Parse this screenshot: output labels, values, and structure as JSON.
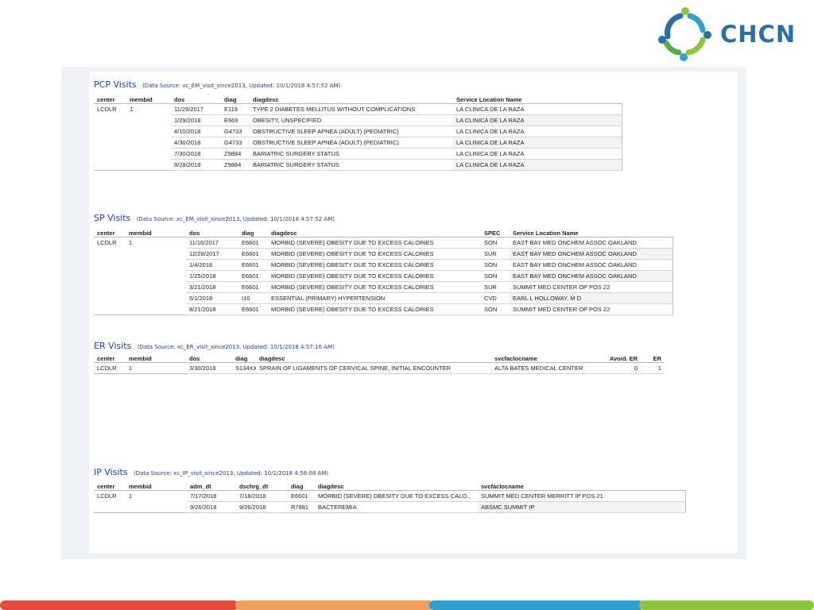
{
  "brand": {
    "name": "CHCN",
    "colors": {
      "primary": "#2b6fa3",
      "green": "#8cc63f",
      "red": "#e34b3e",
      "orange": "#f0a05a",
      "blue": "#2f9fd0"
    }
  },
  "pcp": {
    "title": "PCP Visits",
    "source": "(Data Source: xc_EM_visit_since2013, Updated: 10/1/2018 4:57:52 AM)",
    "headers": {
      "center": "center",
      "membid": "membid",
      "dos": "dos",
      "diag": "diag",
      "diagdesc": "diagdesc",
      "loc": "Service Location Name"
    },
    "group": {
      "center": "LCDLR",
      "membid": "1:"
    },
    "rows": [
      {
        "dos": "11/29/2017",
        "diag": "E119",
        "diagdesc": "TYPE 2 DIABETES MELLITUS WITHOUT COMPLICATIONS",
        "loc": "LA CLINICA DE LA RAZA"
      },
      {
        "dos": "1/29/2018",
        "diag": "E669",
        "diagdesc": "OBESITY, UNSPECIFIED",
        "loc": "LA CLINICA DE LA RAZA"
      },
      {
        "dos": "4/10/2018",
        "diag": "G4733",
        "diagdesc": "OBSTRUCTIVE SLEEP APNEA (ADULT) (PEDIATRIC)",
        "loc": "LA CLINICA DE LA RAZA"
      },
      {
        "dos": "4/30/2018",
        "diag": "G4733",
        "diagdesc": "OBSTRUCTIVE SLEEP APNEA (ADULT) (PEDIATRIC)",
        "loc": "LA CLINICA DE LA RAZA"
      },
      {
        "dos": "7/30/2018",
        "diag": "Z9884",
        "diagdesc": "BARIATRIC SURGERY STATUS",
        "loc": "LA CLINICA DE LA RAZA"
      },
      {
        "dos": "8/28/2018",
        "diag": "Z9884",
        "diagdesc": "BARIATRIC SURGERY STATUS",
        "loc": "LA CLINICA DE LA RAZA"
      }
    ]
  },
  "sp": {
    "title": "SP Visits",
    "source": "(Data Source: xc_EM_visit_since2013, Updated: 10/1/2018 4:57:52 AM)",
    "headers": {
      "center": "center",
      "membid": "membid",
      "dos": "dos",
      "diag": "diag",
      "diagdesc": "diagdesc",
      "spec": "SPEC",
      "loc": "Service Location Name"
    },
    "group": {
      "center": "LCDLR",
      "membid": "1"
    },
    "rows": [
      {
        "dos": "11/16/2017",
        "diag": "E6601",
        "diagdesc": "MORBID (SEVERE) OBESITY DUE TO EXCESS CALORIES",
        "spec": "SON",
        "loc": "EAST BAY MED ONCHEM ASSOC OAKLAND"
      },
      {
        "dos": "12/28/2017",
        "diag": "E6601",
        "diagdesc": "MORBID (SEVERE) OBESITY DUE TO EXCESS CALORIES",
        "spec": "SUR",
        "loc": "EAST BAY MED ONCHEM ASSOC OAKLAND"
      },
      {
        "dos": "1/4/2018",
        "diag": "E6601",
        "diagdesc": "MORBID (SEVERE) OBESITY DUE TO EXCESS CALORIES",
        "spec": "SON",
        "loc": "EAST BAY MED ONCHEM ASSOC OAKLAND"
      },
      {
        "dos": "1/25/2018",
        "diag": "E6601",
        "diagdesc": "MORBID (SEVERE) OBESITY DUE TO EXCESS CALORIES",
        "spec": "SON",
        "loc": "EAST BAY MED ONCHEM ASSOC OAKLAND"
      },
      {
        "dos": "3/21/2018",
        "diag": "E6601",
        "diagdesc": "MORBID (SEVERE) OBESITY DUE TO EXCESS CALORIES",
        "spec": "SUR",
        "loc": "SUMMIT MED CENTER OP POS 22"
      },
      {
        "dos": "5/1/2018",
        "diag": "I10",
        "diagdesc": "ESSENTIAL (PRIMARY) HYPERTENSION",
        "spec": "CVD",
        "loc": "EARL L HOLLOWAY, M D"
      },
      {
        "dos": "8/21/2018",
        "diag": "E6601",
        "diagdesc": "MORBID (SEVERE) OBESITY DUE TO EXCESS CALORIES",
        "spec": "SON",
        "loc": "SUMMIT MED CENTER OP POS 22"
      }
    ]
  },
  "er": {
    "title": "ER Visits",
    "source": "(Data Source: xc_ER_visit_since2013, Updated: 10/1/2018 4:57:16 AM)",
    "headers": {
      "center": "center",
      "membid": "membid",
      "dos": "dos",
      "diag": "diag",
      "diagdesc": "diagdesc",
      "fac": "svcfaclocname",
      "avoid": "Avoid. ER",
      "er": "ER"
    },
    "rows": [
      {
        "center": "LCDLR",
        "membid": "1",
        "dos": "3/30/2018",
        "diag": "S134XX..",
        "diagdesc": "SPRAIN OF LIGAMENTS OF CERVICAL SPINE, INITIAL ENCOUNTER",
        "fac": "ALTA BATES MEDICAL CENTER",
        "avoid": "0",
        "er": "1"
      }
    ]
  },
  "ip": {
    "title": "IP Visits",
    "source": "(Data Source: xc_IP_visit_since2013, Updated: 10/1/2018 4:58:08 AM)",
    "headers": {
      "center": "center",
      "membid": "membid",
      "adm": "adm_dt",
      "dschrg": "dschrg_dt",
      "diag": "diag",
      "diagdesc": "diagdesc",
      "fac": "svcfaclocname"
    },
    "group": {
      "center": "LCDLR",
      "membid": "1"
    },
    "rows": [
      {
        "adm": "7/17/2018",
        "dschrg": "7/18/2018",
        "diag": "E6601",
        "diagdesc": "MORBID (SEVERE) OBESITY DUE TO EXCESS CALO..",
        "fac": "SUMMIT MED CENTER MERRITT IP POS 21"
      },
      {
        "adm": "9/26/2018",
        "dschrg": "9/26/2018",
        "diag": "R7881",
        "diagdesc": "BACTEREMIA",
        "fac": "ABSMC SUMMIT IP"
      }
    ]
  }
}
